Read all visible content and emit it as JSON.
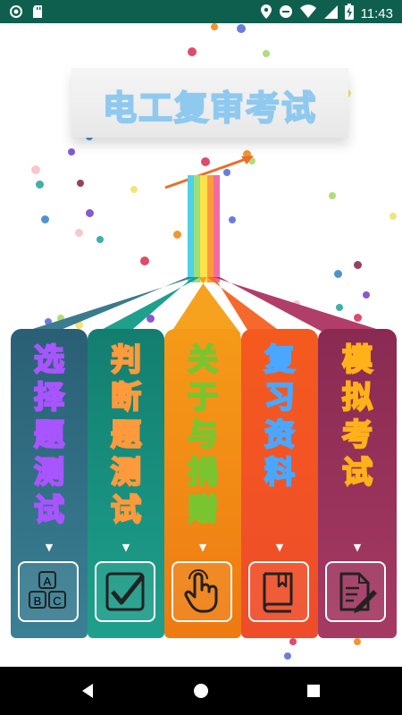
{
  "status_bar": {
    "time": "11:43"
  },
  "title": "电工复审考试",
  "panels": [
    {
      "label": "选择题测试",
      "icon": "abc-blocks-icon",
      "color": "#a855ff"
    },
    {
      "label": "判断题测试",
      "icon": "checkmark-icon",
      "color": "#ff9a3c"
    },
    {
      "label": "关于与捐赠",
      "icon": "hand-pointer-icon",
      "color": "#79c52f"
    },
    {
      "label": "复习资料",
      "icon": "book-icon",
      "color": "#4aa7ff"
    },
    {
      "label": "模拟考试",
      "icon": "exam-paper-icon",
      "color": "#ffb11a"
    }
  ],
  "icon_letters": [
    "A",
    "B",
    "C"
  ],
  "colors": {
    "status_bar": "#0f5f4f",
    "panel_1": "#2f6e83",
    "panel_2": "#1e8b7c",
    "panel_3": "#f08a1a",
    "panel_4": "#f25a23",
    "panel_5": "#9d2f57"
  }
}
